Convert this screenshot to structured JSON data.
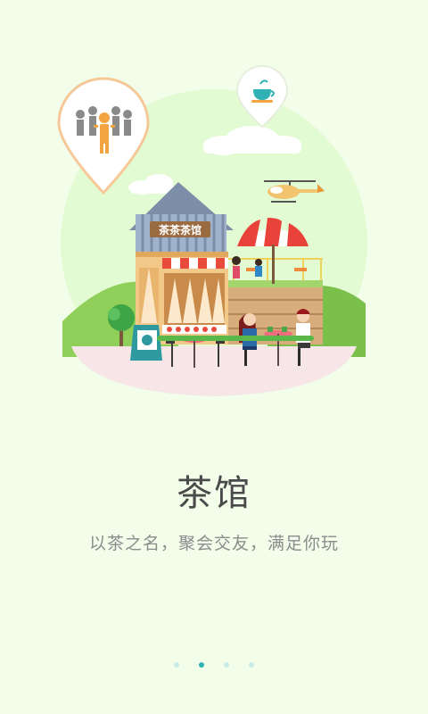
{
  "onboarding": {
    "title": "茶馆",
    "subtitle": "以茶之名，聚会交友，满足你玩",
    "page_count": 4,
    "active_page": 2
  },
  "illustration": {
    "shop_sign": "茶茶茶馆"
  },
  "colors": {
    "background": "#f2fdea",
    "circle": "#e6fbd6",
    "accent_teal": "#30b2b5",
    "dot_inactive": "#c7ebe6",
    "title": "#4a4a4a",
    "subtitle": "#8c8c8c"
  },
  "icons": {
    "left_pin": "crowd-pin-icon",
    "right_pin": "tea-cup-pin-icon"
  }
}
